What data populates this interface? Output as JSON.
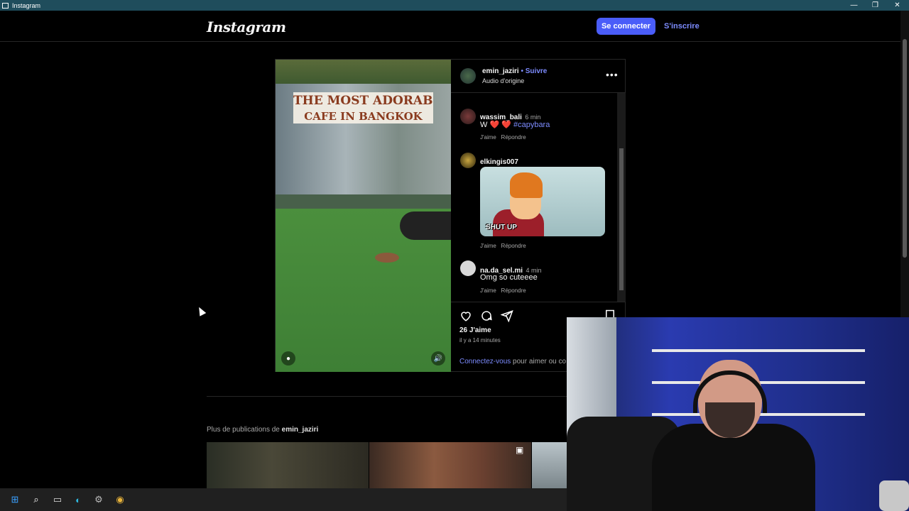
{
  "window": {
    "title": "Instagram",
    "app_icon": "window-icon"
  },
  "header": {
    "logo": "Instagram",
    "login_label": "Se connecter",
    "signup_label": "S'inscrire"
  },
  "post": {
    "author": "emin_jaziri",
    "follow_label": "• Suivre",
    "audio": "Audio d'origine",
    "video_caption_line1": "THE MOST ADORABLE",
    "video_caption_line2": "CAFE IN BANGKOK",
    "comments": [
      {
        "user": "wassim_bali",
        "time": "6 min",
        "text_prefix": "W",
        "text_hearts": "❤️ ❤️",
        "hashtag": "#capybara",
        "like": "J'aime",
        "reply": "Répondre"
      },
      {
        "user": "elkingis007",
        "time": "",
        "meme_text": "SHUT UP",
        "like": "J'aime",
        "reply": "Répondre"
      },
      {
        "user": "na.da_sel.mi",
        "time": "4 min",
        "text": "Omg so cuteeee",
        "like": "J'aime",
        "reply": "Répondre"
      }
    ],
    "likes": "26 J'aime",
    "timestamp": "il y a 14 minutes",
    "login_link": "Connectez-vous",
    "login_rest": "pour aimer ou co"
  },
  "more_posts": {
    "prefix": "Plus de publications de",
    "user": "emin_jaziri"
  },
  "taskbar": {
    "items": [
      "windows-start-icon",
      "search-icon",
      "file-explorer-icon",
      "edge-icon",
      "settings-icon",
      "chrome-icon"
    ]
  }
}
